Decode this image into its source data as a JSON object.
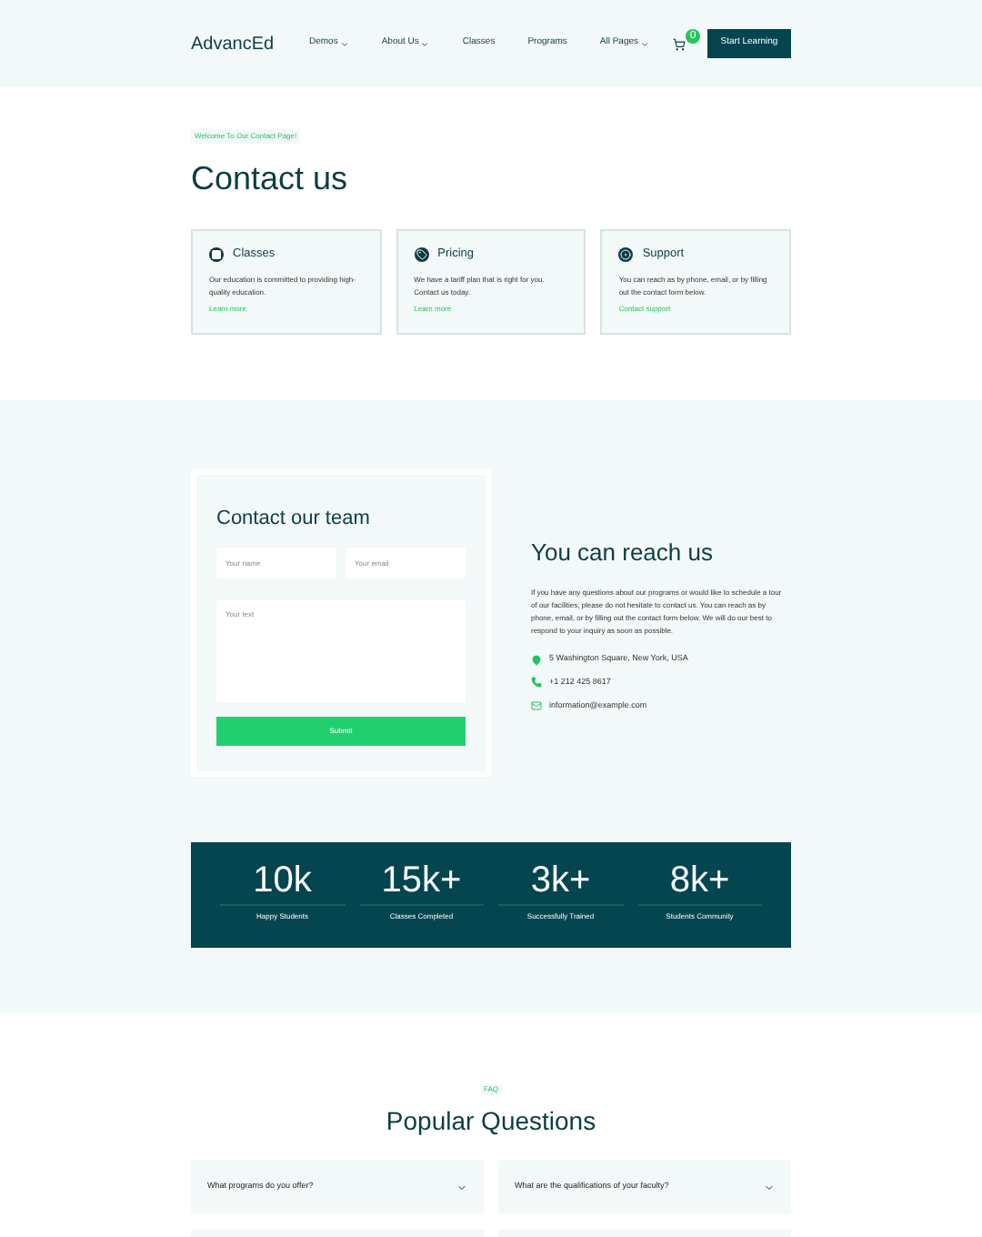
{
  "nav": {
    "logo": "AdvancEd",
    "items": [
      {
        "label": "Demos",
        "dropdown": true
      },
      {
        "label": "About Us",
        "dropdown": true
      },
      {
        "label": "Classes",
        "dropdown": false
      },
      {
        "label": "Programs",
        "dropdown": false
      },
      {
        "label": "All Pages",
        "dropdown": true
      }
    ],
    "cart_count": "0",
    "cta": "Start Learning"
  },
  "hero": {
    "tag": "Welcome To Our Contact Page!",
    "title": "Contact us"
  },
  "cards": [
    {
      "kind": "classes",
      "title": "Classes",
      "text": "Our education is committed to providing high-quality education.",
      "link": "Learn more"
    },
    {
      "kind": "pricing",
      "title": "Pricing",
      "text": "We have a tariff plan that is right for you. Contact us today.",
      "link": "Learn more"
    },
    {
      "kind": "support",
      "title": "Support",
      "text": "You can reach as by phone, email, or by filling out the contact form below.",
      "link": "Contact support"
    }
  ],
  "form": {
    "title": "Contact our team",
    "name_placeholder": "Your name",
    "email_placeholder": "Your email",
    "text_placeholder": "Your text",
    "submit": "Submit"
  },
  "reach": {
    "title": "You can reach us",
    "text": "If you have any questions about our programs or would like to schedule a tour of our facilities, please do not hesitate to contact us. You can reach as by phone, email, or by filling out the contact form below. We will do our best to respond to your inquiry as soon as possible.",
    "contacts": [
      {
        "kind": "address",
        "text": "5 Washington Square, New York, USA"
      },
      {
        "kind": "phone",
        "text": "+1 212 425 8617"
      },
      {
        "kind": "email",
        "text": "information@example.com"
      }
    ]
  },
  "stats": [
    {
      "value": "10k",
      "label": "Happy Students"
    },
    {
      "value": "15k+",
      "label": "Classes Completed"
    },
    {
      "value": "3k+",
      "label": "Successfully Trained"
    },
    {
      "value": "8k+",
      "label": "Students Community"
    }
  ],
  "faq": {
    "tag": "FAQ",
    "title": "Popular Questions",
    "questions": [
      {
        "text": "What programs do you offer?",
        "expanded": false
      },
      {
        "text": "What are the qualifications of your faculty?",
        "expanded": false
      }
    ]
  }
}
